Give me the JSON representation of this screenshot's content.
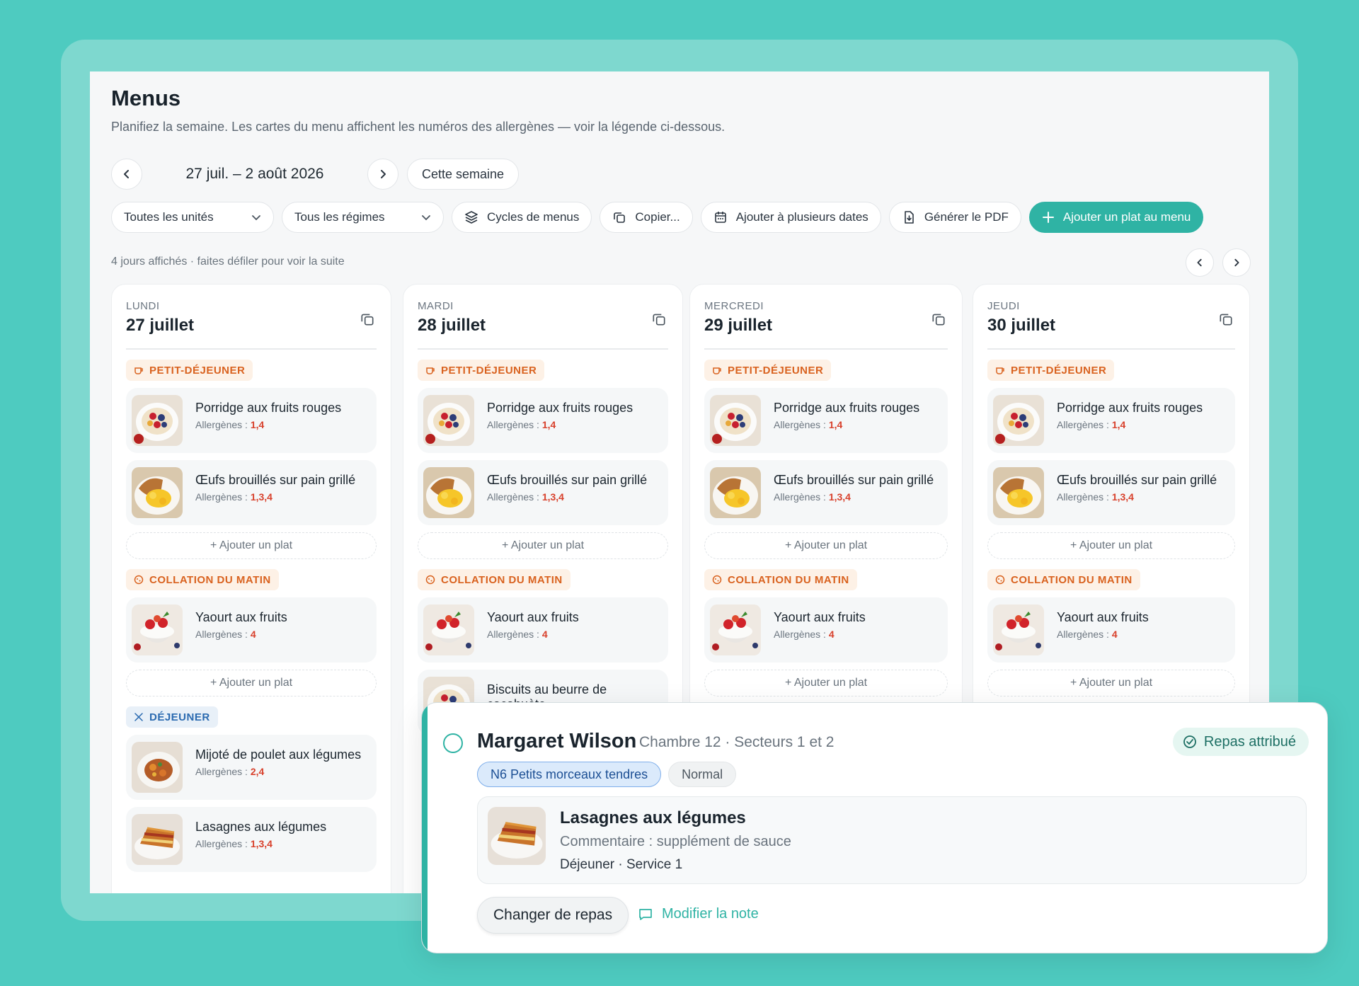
{
  "header": {
    "title": "Menus",
    "subtitle": "Planifiez la semaine. Les cartes du menu affichent les numéros des allergènes — voir la légende ci-dessous."
  },
  "week": {
    "prev_icon": "chevron-left-icon",
    "label": "27 juil. – 2 août 2026",
    "next_icon": "chevron-right-icon",
    "this_week": "Cette semaine"
  },
  "toolbar": {
    "units": "Toutes les unités",
    "diets": "Tous les régimes",
    "cycles": "Cycles de menus",
    "copy": "Copier...",
    "multi_dates": "Ajouter à plusieurs dates",
    "pdf": "Générer le PDF",
    "add_dish": "Ajouter un plat au menu"
  },
  "days_info": "4 jours affichés · faites défiler pour voir la suite",
  "common": {
    "allergen_prefix": "Allergènes :",
    "add_dish": "+ Ajouter un plat"
  },
  "days": [
    {
      "name": "LUNDI",
      "date": "27 juillet",
      "breakfast": {
        "label": "PETIT-DÉJEUNER",
        "dishes": [
          {
            "name": "Porridge aux fruits rouges",
            "allergens": "1,4"
          },
          {
            "name": "Œufs brouillés sur pain grillé",
            "allergens": "1,3,4"
          }
        ]
      },
      "snack": {
        "label": "COLLATION DU MATIN",
        "dishes": [
          {
            "name": "Yaourt aux fruits",
            "allergens": "4"
          }
        ]
      },
      "lunch": {
        "label": "DÉJEUNER",
        "dishes": [
          {
            "name": "Mijoté de poulet aux légumes",
            "allergens": "2,4"
          },
          {
            "name": "Lasagnes aux légumes",
            "allergens": "1,3,4"
          }
        ]
      }
    },
    {
      "name": "MARDI",
      "date": "28 juillet",
      "breakfast": {
        "label": "PETIT-DÉJEUNER",
        "dishes": [
          {
            "name": "Porridge aux fruits rouges",
            "allergens": "1,4"
          },
          {
            "name": "Œufs brouillés sur pain grillé",
            "allergens": "1,3,4"
          }
        ]
      },
      "snack": {
        "label": "COLLATION DU MATIN",
        "dishes": [
          {
            "name": "Yaourt aux fruits",
            "allergens": "4"
          },
          {
            "name": "Biscuits au beurre de cacahuète",
            "allergens": ""
          }
        ]
      }
    },
    {
      "name": "MERCREDI",
      "date": "29 juillet",
      "breakfast": {
        "label": "PETIT-DÉJEUNER",
        "dishes": [
          {
            "name": "Porridge aux fruits rouges",
            "allergens": "1,4"
          },
          {
            "name": "Œufs brouillés sur pain grillé",
            "allergens": "1,3,4"
          }
        ]
      },
      "snack": {
        "label": "COLLATION DU MATIN",
        "dishes": [
          {
            "name": "Yaourt aux fruits",
            "allergens": "4"
          }
        ]
      }
    },
    {
      "name": "JEUDI",
      "date": "30 juillet",
      "breakfast": {
        "label": "PETIT-DÉJEUNER",
        "dishes": [
          {
            "name": "Porridge aux fruits rouges",
            "allergens": "1,4"
          },
          {
            "name": "Œufs brouillés sur pain grillé",
            "allergens": "1,3,4"
          }
        ]
      },
      "snack": {
        "label": "COLLATION DU MATIN",
        "dishes": [
          {
            "name": "Yaourt aux fruits",
            "allergens": "4"
          }
        ]
      }
    }
  ],
  "resident": {
    "name": "Margaret Wilson",
    "room": "Chambre 12 · Secteurs 1 et 2",
    "status": "Repas attribué",
    "texture_chip": "N6 Petits morceaux tendres",
    "fluid_chip": "Normal",
    "dish": "Lasagnes aux légumes",
    "comment": "Commentaire : supplément de sauce",
    "service": "Déjeuner · Service 1",
    "change_button": "Changer de repas",
    "edit_note": "Modifier la note"
  },
  "colors": {
    "accent": "#2fb3a4",
    "background": "#4ecbc0",
    "allergen": "#d8412c",
    "meal_tag_orange": "#d9621f",
    "meal_tag_blue": "#2a6ab0"
  }
}
